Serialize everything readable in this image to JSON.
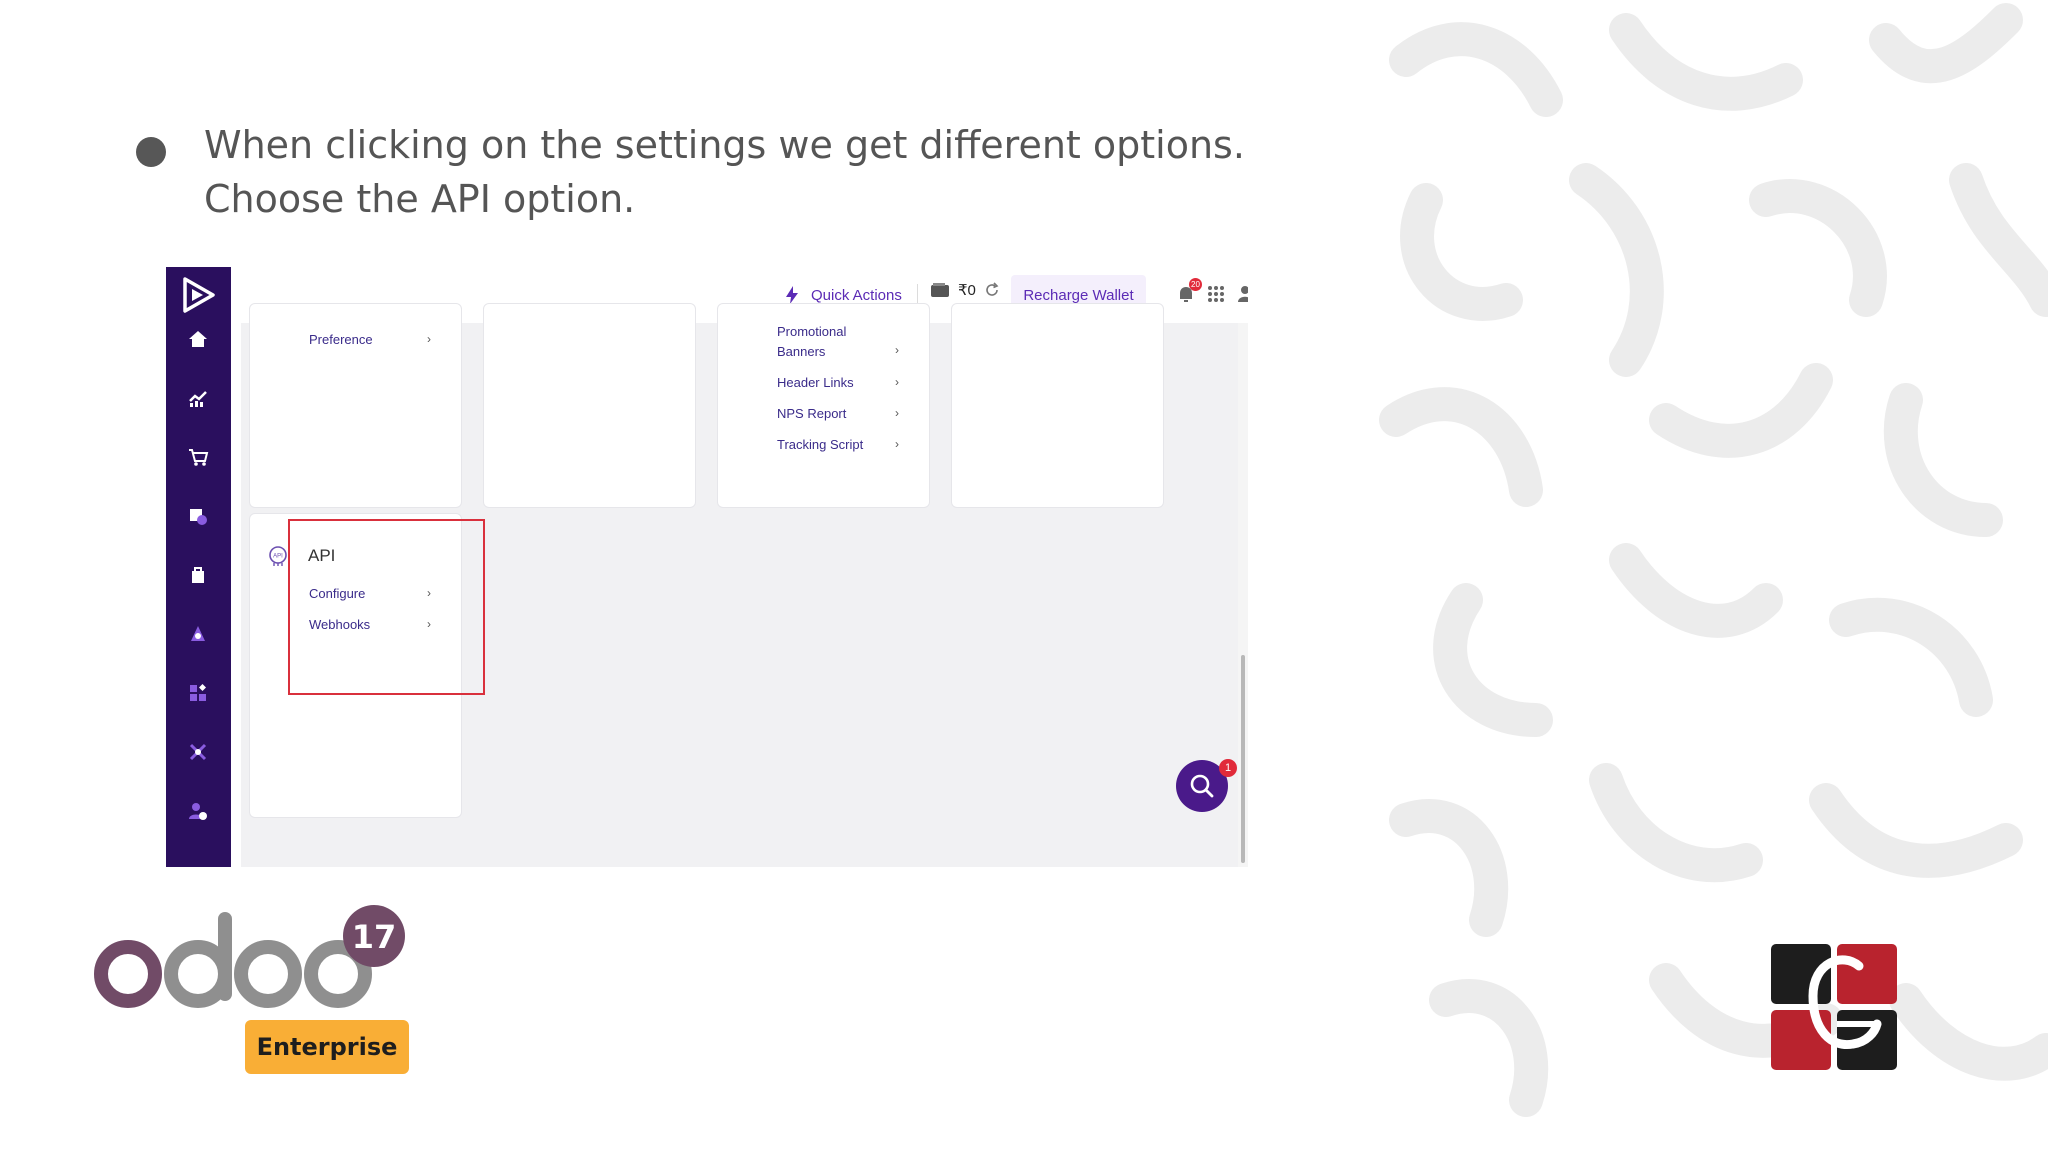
{
  "slide": {
    "bullet_text_line1": "When clicking on the settings we get different options.",
    "bullet_text_line2": "Choose the API option."
  },
  "topbar": {
    "quick_actions_label": "Quick Actions",
    "wallet_balance": "₹0",
    "recharge_label": "Recharge Wallet",
    "notification_count": "20"
  },
  "cards": {
    "preference_label": "Preference",
    "promotional_banners_line1": "Promotional",
    "promotional_banners_line2": "Banners",
    "header_links_label": "Header Links",
    "nps_report_label": "NPS Report",
    "tracking_script_label": "Tracking Script"
  },
  "api_card": {
    "title": "API",
    "configure_label": "Configure",
    "webhooks_label": "Webhooks"
  },
  "fab": {
    "badge_count": "1"
  },
  "odoo": {
    "version": "17",
    "edition_label": "Enterprise"
  },
  "colors": {
    "sidebar": "#2a0f5e",
    "accent_purple": "#5b2bb5",
    "highlight_red": "#d9303c",
    "odoo_purple": "#714b67",
    "enterprise_orange": "#f9ae36"
  }
}
